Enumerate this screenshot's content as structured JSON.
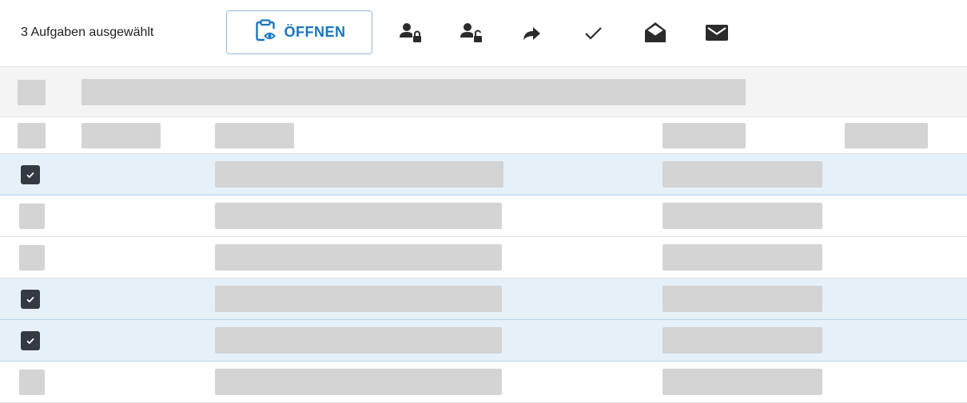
{
  "toolbar": {
    "selection_text": "3 Aufgaben ausgewählt",
    "open_label": "ÖFFNEN",
    "open_icon": "clipboard-eye-icon",
    "accent_color": "#1a75bb",
    "icons": [
      "user-lock-icon",
      "user-unlock-icon",
      "forward-icon",
      "check-icon",
      "envelope-open-icon",
      "envelope-icon"
    ]
  },
  "table": {
    "rows": [
      {
        "checked": true
      },
      {
        "checked": false
      },
      {
        "checked": false
      },
      {
        "checked": true
      },
      {
        "checked": true
      },
      {
        "checked": false
      }
    ],
    "selected_row_color": "#e6f0f8",
    "checkbox_color": "#343a40"
  }
}
